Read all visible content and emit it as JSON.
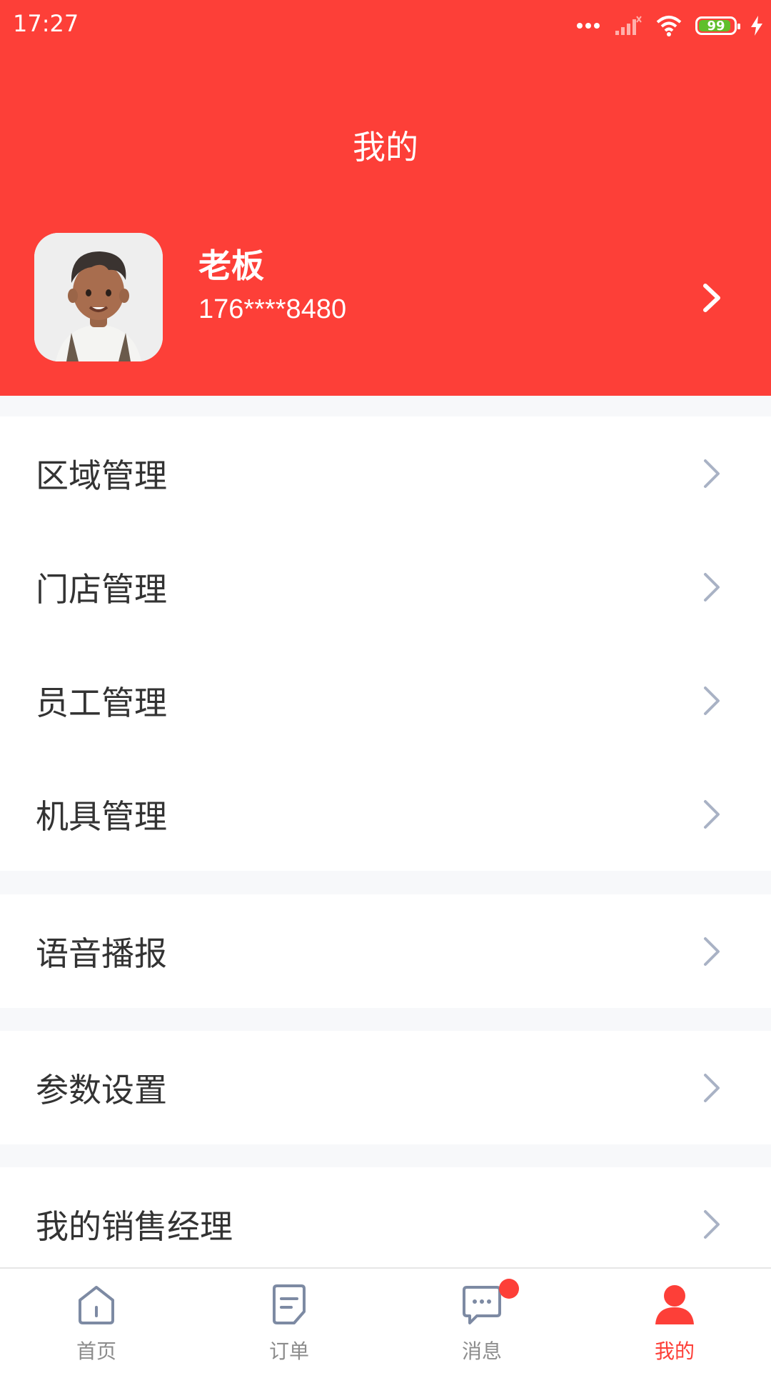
{
  "status_bar": {
    "time": "17:27",
    "battery": "99"
  },
  "header": {
    "title": "我的"
  },
  "profile": {
    "name": "老板",
    "phone": "176****8480"
  },
  "menu_groups": [
    [
      "区域管理",
      "门店管理",
      "员工管理",
      "机具管理"
    ],
    [
      "语音播报"
    ],
    [
      "参数设置"
    ],
    [
      "我的销售经理"
    ]
  ],
  "tabbar": {
    "items": [
      {
        "label": "首页",
        "icon": "home-icon"
      },
      {
        "label": "订单",
        "icon": "order-icon"
      },
      {
        "label": "消息",
        "icon": "message-icon",
        "badge": true
      },
      {
        "label": "我的",
        "icon": "user-icon",
        "active": true
      }
    ]
  },
  "colors": {
    "primary": "#fd3f38",
    "text": "#333333",
    "chevron": "#a9b2c5",
    "badge": "#fd3f38"
  }
}
